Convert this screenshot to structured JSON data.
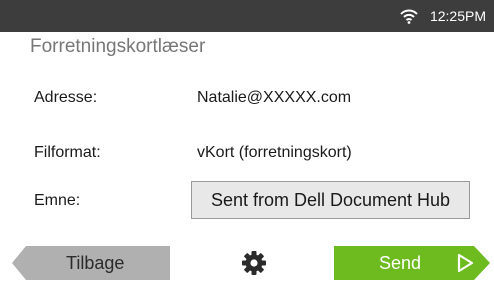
{
  "status": {
    "time": "12:25PM",
    "wifi_icon": "wifi-icon"
  },
  "app": {
    "title": "Forretningskortlæser"
  },
  "fields": {
    "address": {
      "label": "Adresse:",
      "value": "Natalie@XXXXX.com"
    },
    "format": {
      "label": "Filformat:",
      "value": "vKort (forretningskort)"
    },
    "subject": {
      "label": "Emne:",
      "value": "Sent from Dell Document Hub"
    }
  },
  "buttons": {
    "back_label": "Tilbage",
    "send_label": "Send",
    "settings_icon": "gear-icon"
  },
  "colors": {
    "status_bar": "#3d3d3d",
    "back_button": "#b0b0b0",
    "send_button": "#6dbb1f",
    "field_background": "#e8e8e8"
  }
}
